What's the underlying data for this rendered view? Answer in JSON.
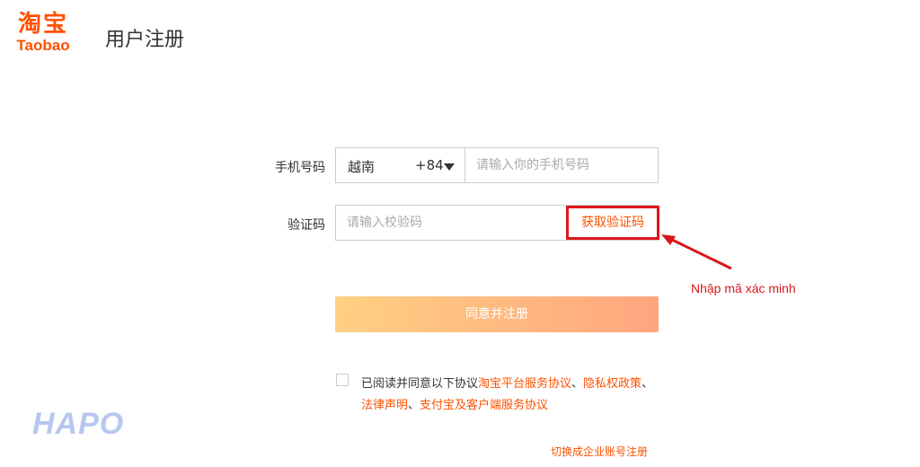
{
  "logo": {
    "chinese": "淘宝",
    "english": "Taobao"
  },
  "page_title": "用户注册",
  "phone": {
    "label": "手机号码",
    "country": "越南",
    "country_code": "+84",
    "placeholder": "请输入你的手机号码"
  },
  "verification": {
    "label": "验证码",
    "placeholder": "请输入校验码",
    "get_code_label": "获取验证码"
  },
  "annotation": {
    "text": "Nhập mã xác minh"
  },
  "register_button": "同意并注册",
  "agreement": {
    "prefix": "已阅读并同意以下协议",
    "link1": "淘宝平台服务协议",
    "sep1": "、",
    "link2": "隐私权政策",
    "sep2": "、",
    "link3": "法律声明",
    "sep3": "、",
    "link4": "支付宝及客户端服务协议"
  },
  "enterprise_link": "切换成企业账号注册",
  "watermark": "HAPO",
  "colors": {
    "brand": "#ff5000",
    "annotation": "#d8161b",
    "button_start": "#ffd083",
    "button_end": "#ffa57f"
  }
}
